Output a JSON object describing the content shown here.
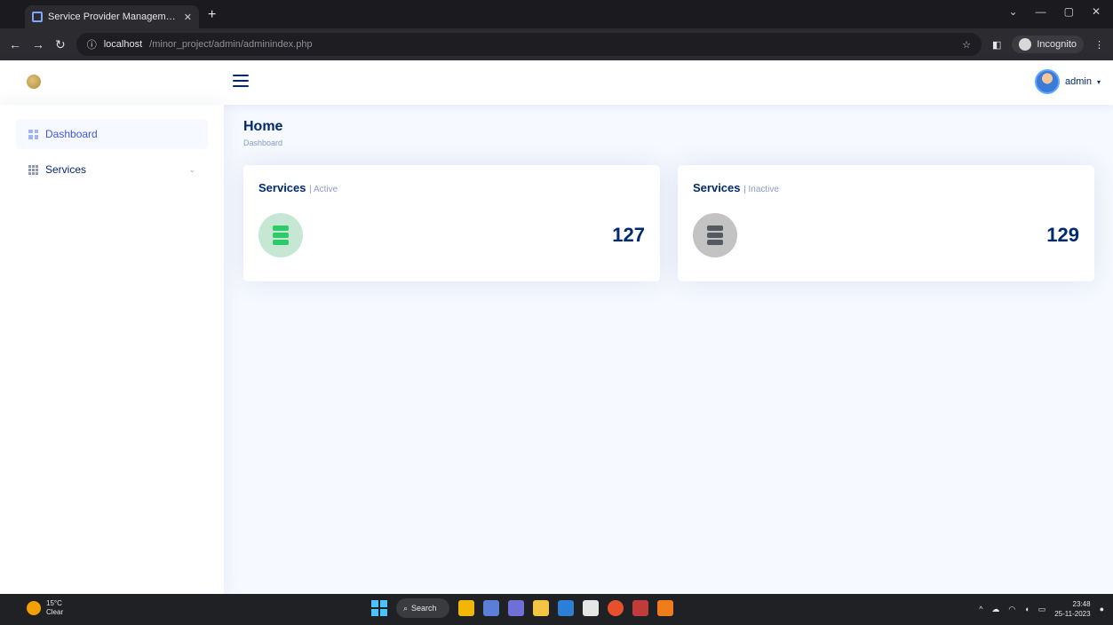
{
  "browser": {
    "tab_title": "Service Provider Management S",
    "url_host": "localhost",
    "url_path": "/minor_project/admin/adminindex.php",
    "incognito_label": "Incognito",
    "window_controls": [
      "⌄",
      "—",
      "▢",
      "✕"
    ]
  },
  "header": {
    "user_name": "admin"
  },
  "sidebar": {
    "items": [
      {
        "label": "Dashboard",
        "icon": "grid-icon",
        "active": true
      },
      {
        "label": "Services",
        "icon": "list-icon",
        "active": false,
        "has_submenu": true
      }
    ]
  },
  "main": {
    "title": "Home",
    "breadcrumb": "Dashboard",
    "cards": [
      {
        "title": "Services",
        "subtitle": "| Active",
        "value": "127",
        "icon": "server-icon",
        "icon_color": "#2eca6a"
      },
      {
        "title": "Services",
        "subtitle": "| Inactive",
        "value": "129",
        "icon": "server-icon",
        "icon_color": "#555a60"
      }
    ]
  },
  "taskbar": {
    "weather_temp": "15°C",
    "weather_desc": "Clear",
    "search_label": "Search",
    "time": "23:48",
    "date": "25-11-2023"
  },
  "colors": {
    "accent": "#4154f1",
    "heading": "#012970",
    "muted": "#899bbd",
    "page_bg": "#f6f9ff"
  }
}
